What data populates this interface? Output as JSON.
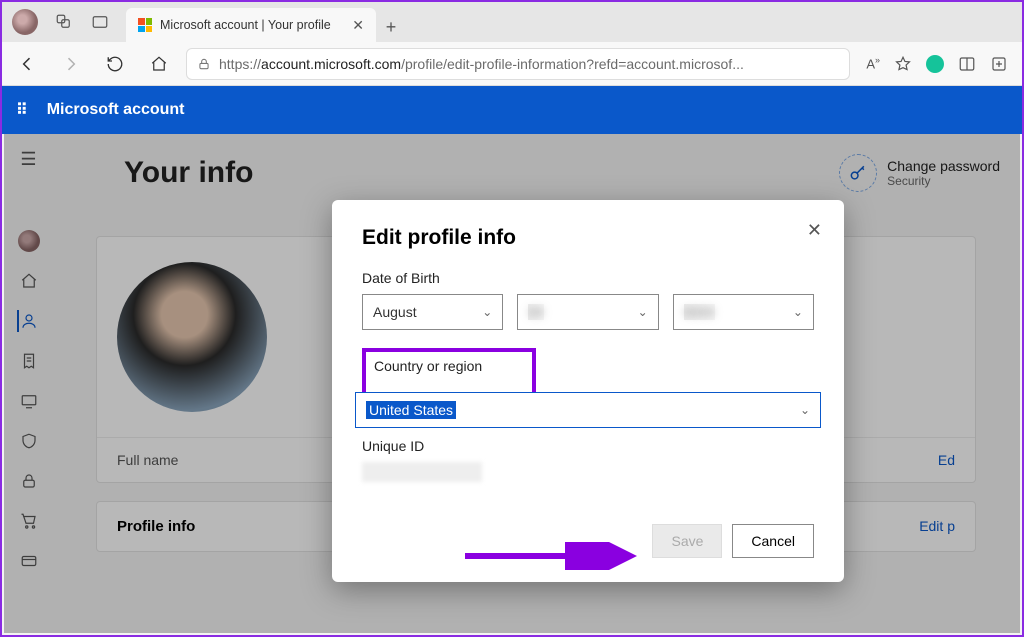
{
  "browser": {
    "tab_title": "Microsoft account | Your profile",
    "url_host": "account.microsoft.com",
    "url_path": "/profile/edit-profile-information?refd=account.microsof..."
  },
  "app": {
    "header_title": "Microsoft account"
  },
  "page": {
    "title": "Your info",
    "change_password": "Change password",
    "change_password_sub": "Security",
    "full_name_label": "Full name",
    "edit_link": "Ed",
    "profile_info_label": "Profile info",
    "edit_profile_link": "Edit p"
  },
  "modal": {
    "title": "Edit profile info",
    "dob_label": "Date of Birth",
    "month_value": "August",
    "region_label": "Country or region",
    "region_value": "United States",
    "uid_label": "Unique ID",
    "save_label": "Save",
    "cancel_label": "Cancel"
  }
}
